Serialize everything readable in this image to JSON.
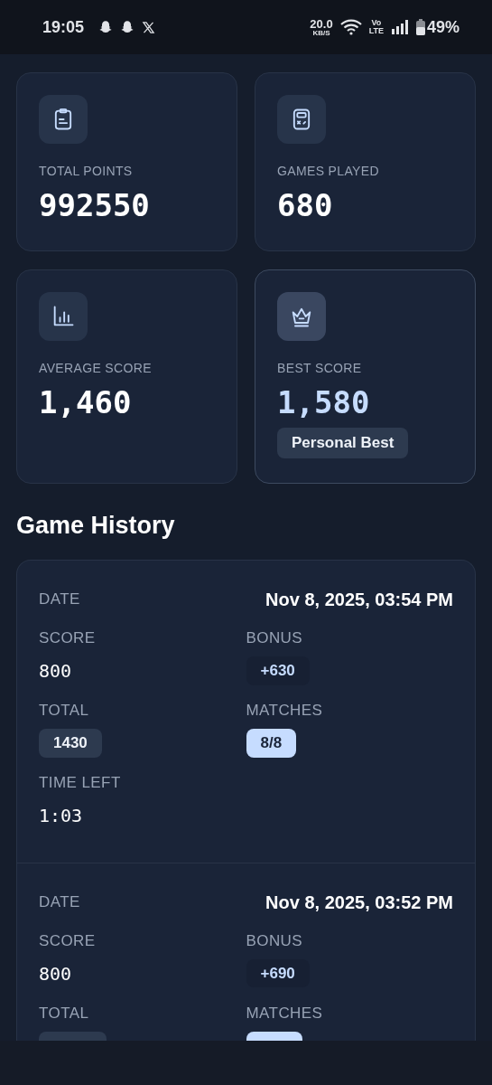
{
  "status_bar": {
    "time": "19:05",
    "net_speed": "20.0",
    "net_unit": "KB/S",
    "volte_top": "Vo",
    "volte_bottom": "LTE",
    "battery": "49%"
  },
  "stats": [
    {
      "kind": "clipboard",
      "label": "TOTAL POINTS",
      "value": "992550",
      "highlighted": false
    },
    {
      "kind": "handheld",
      "label": "GAMES PLAYED",
      "value": "680",
      "highlighted": false
    },
    {
      "kind": "chart",
      "label": "AVERAGE SCORE",
      "value": "1,460",
      "highlighted": false
    },
    {
      "kind": "crown",
      "label": "BEST SCORE",
      "value": "1,580",
      "highlighted": true,
      "badge": "Personal Best"
    }
  ],
  "history": {
    "title": "Game History",
    "games": [
      {
        "date_label": "DATE",
        "date": "Nov 8, 2025, 03:54 PM",
        "score_label": "SCORE",
        "score": "800",
        "bonus_label": "BONUS",
        "bonus": "+630",
        "total_label": "TOTAL",
        "total": "1430",
        "matches_label": "MATCHES",
        "matches": "8/8",
        "time_label": "TIME LEFT",
        "time_left": "1:03"
      },
      {
        "date_label": "DATE",
        "date": "Nov 8, 2025, 03:52 PM",
        "score_label": "SCORE",
        "score": "800",
        "bonus_label": "BONUS",
        "bonus": "+690",
        "total_label": "TOTAL",
        "matches_label": "MATCHES"
      }
    ]
  }
}
